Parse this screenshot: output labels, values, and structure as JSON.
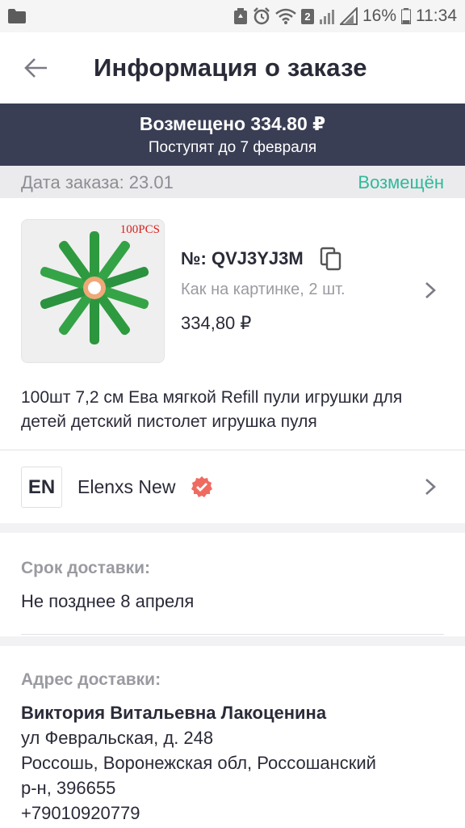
{
  "status_bar": {
    "wifi_badge": "2",
    "battery": "16%",
    "time": "11:34"
  },
  "header": {
    "title": "Информация о заказе"
  },
  "refund": {
    "amount": "Возмещено 334.80 ₽",
    "note": "Поступят до 7 февраля"
  },
  "order": {
    "date_label": "Дата заказа: 23.01",
    "status": "Возмещён"
  },
  "product": {
    "image_label": "100PCS",
    "order_no": "№: QVJ3YJ3M",
    "variant": "Как на картинке, 2 шт.",
    "price": "334,80 ₽",
    "title": "100шт 7,2 см Ева мягкой Refill пули игрушки для детей детский пистолет игрушка пуля"
  },
  "seller": {
    "logo_text": "EN",
    "name": "Elenxs New"
  },
  "delivery": {
    "label": "Срок доставки:",
    "value": "Не позднее 8 апреля"
  },
  "address": {
    "label": "Адрес доставки:",
    "name": "Виктория Витальевна Лакоценина",
    "street": "ул Февральская, д. 248",
    "city": "Россошь, Воронежская обл, Россошанский",
    "district": "р-н, 396655",
    "phone": "+79010920779"
  },
  "colors": {
    "banner_bg": "#3a3e54",
    "status_green": "#2fb99b",
    "verified_red": "#ef6b60",
    "product_green": "#2e9a3f",
    "product_orange": "#f0a878"
  }
}
